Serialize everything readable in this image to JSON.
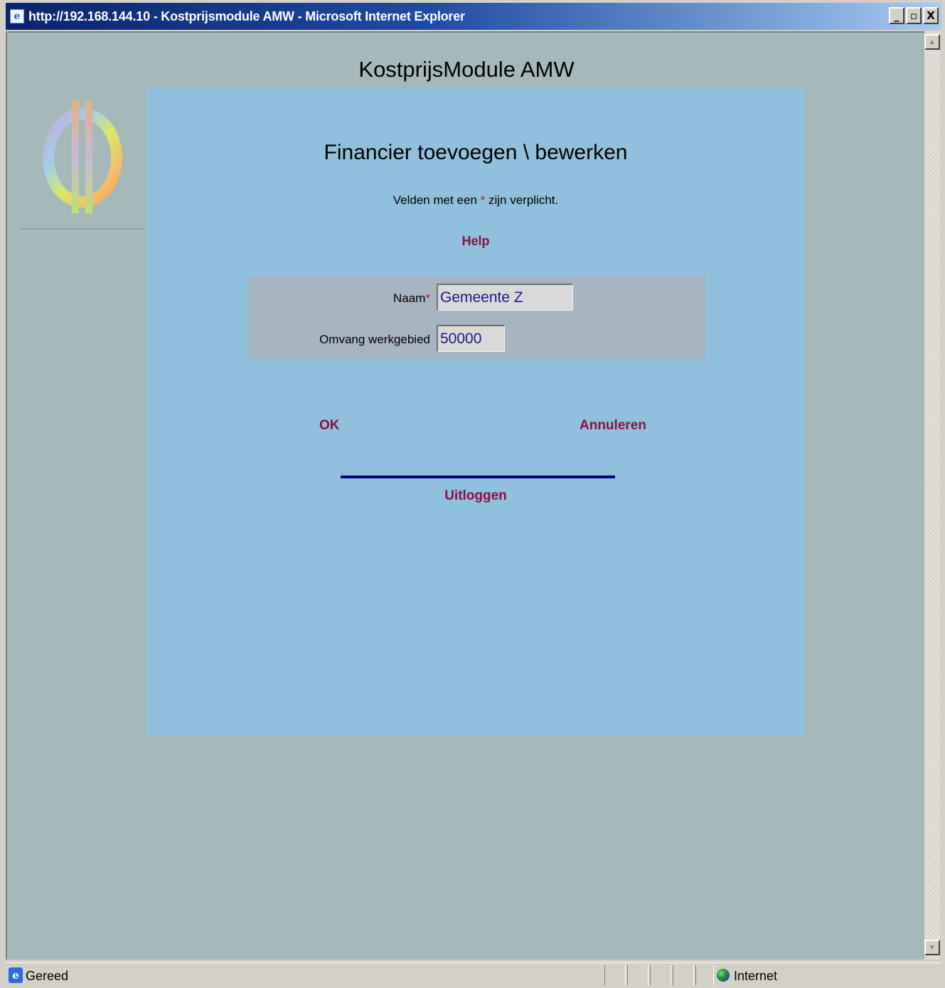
{
  "window": {
    "title": "http://192.168.144.10 - Kostprijsmodule AMW - Microsoft Internet Explorer",
    "minimize_label": "_",
    "maximize_label": "▫",
    "close_label": "X"
  },
  "page": {
    "app_title": "KostprijsModule AMW"
  },
  "form": {
    "title": "Financier toevoegen \\ bewerken",
    "required_note_before": "Velden met een ",
    "required_star": "*",
    "required_note_after": " zijn verplicht.",
    "help_label": "Help",
    "fields": [
      {
        "label": "Naam",
        "required": true,
        "value": "Gemeente Z"
      },
      {
        "label": "Omvang werkgebied",
        "required": false,
        "value": "50000"
      }
    ],
    "ok_label": "OK",
    "cancel_label": "Annuleren",
    "logout_label": "Uitloggen"
  },
  "statusbar": {
    "status_text": "Gereed",
    "zone_text": "Internet",
    "zone_icon": "globe-icon"
  },
  "colors": {
    "page_background": "#a5b8ba",
    "panel_background": "#8fc0de",
    "form_box_background": "#a7b4c2",
    "link_color": "#8b1040",
    "divider_color": "#000080"
  }
}
